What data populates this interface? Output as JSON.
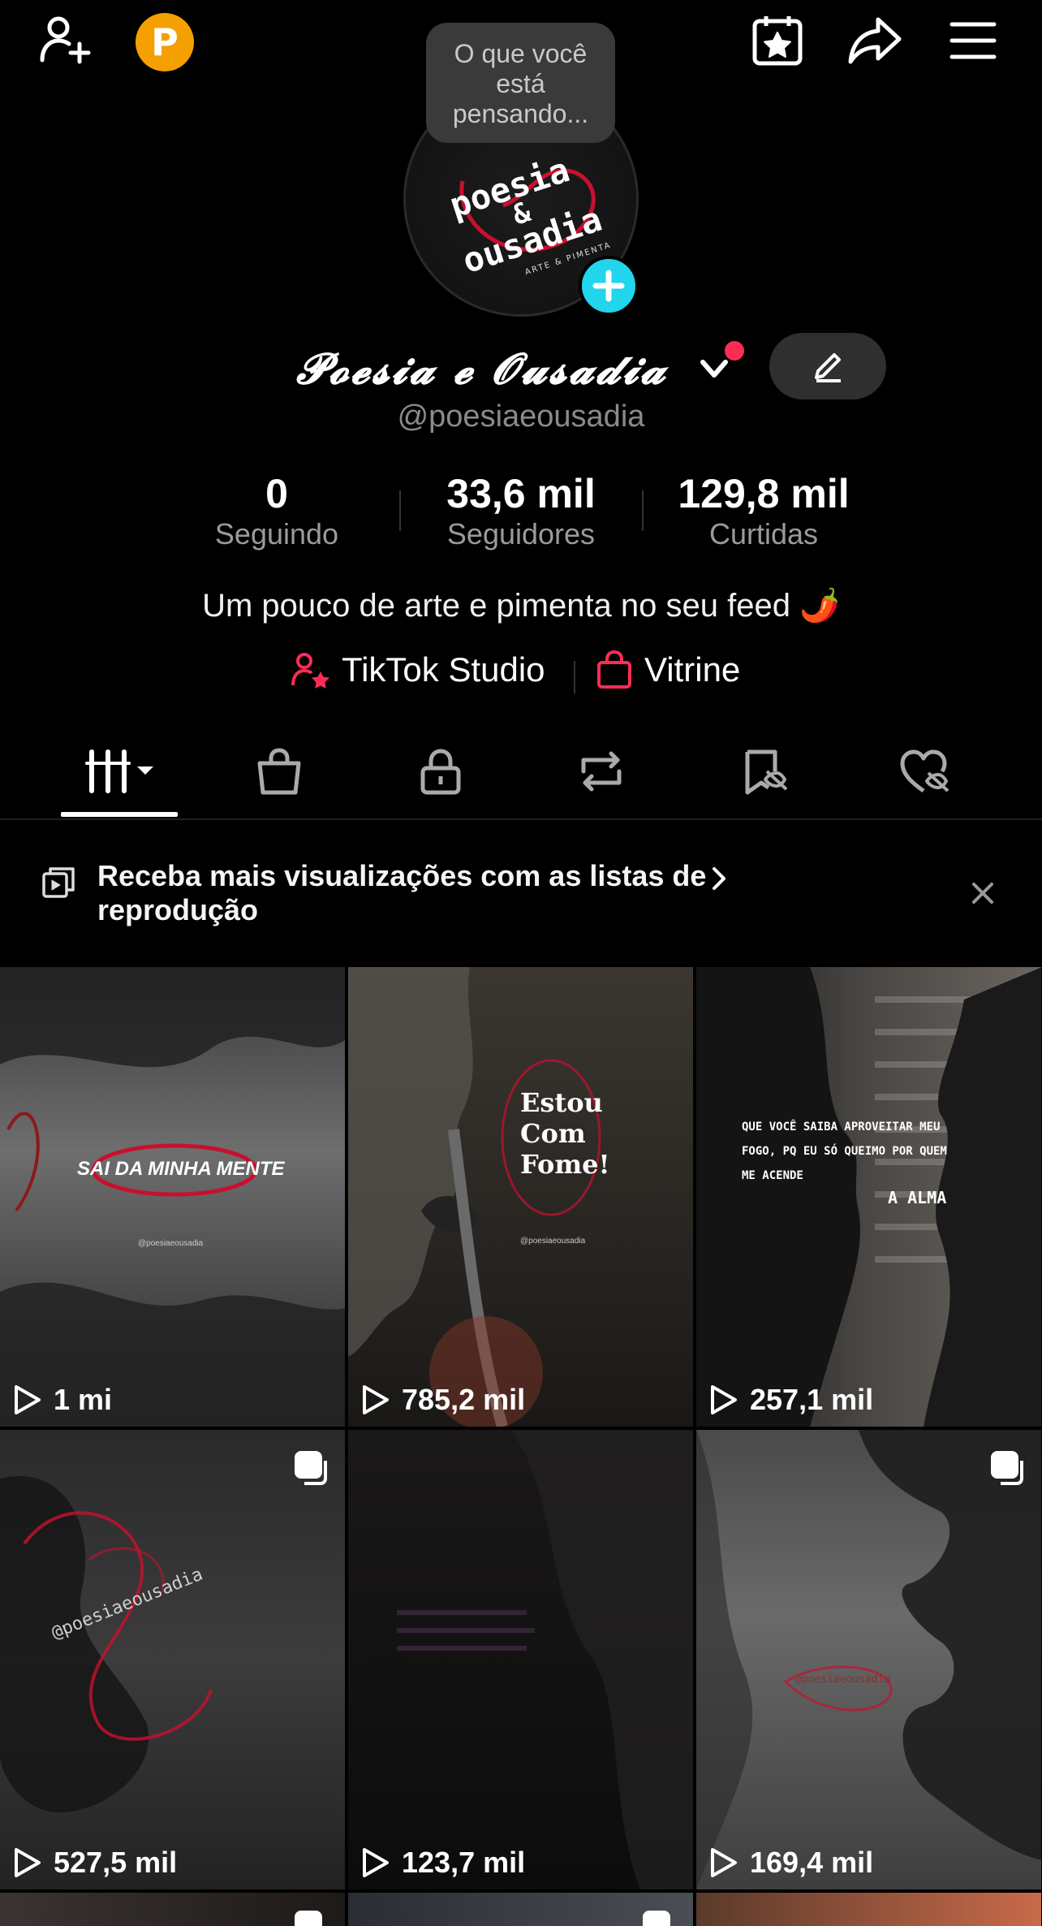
{
  "top_bar": {
    "add_friend_icon": "person-plus-icon",
    "coin_label": "P",
    "calendar_icon": "calendar-star-icon",
    "share_icon": "share-arrow-icon",
    "menu_icon": "hamburger-menu-icon"
  },
  "status_bubble": {
    "text": "O que você está pensando..."
  },
  "profile": {
    "avatar_logo": {
      "line1": "poesia",
      "line2": "&",
      "line3": "ousadia",
      "tagline": "ARTE & PIMENTA"
    },
    "display_name": "𝓟𝓸𝓮𝓼𝓲𝓪 𝓮 𝓞𝓾𝓼𝓪𝓭𝓲𝓪",
    "handle": "@poesiaeousadia"
  },
  "stats": [
    {
      "value": "0",
      "label": "Seguindo"
    },
    {
      "value": "33,6 mil",
      "label": "Seguidores"
    },
    {
      "value": "129,8 mil",
      "label": "Curtidas"
    }
  ],
  "bio": "Um pouco de arte e pimenta no seu feed 🌶️",
  "links": {
    "studio": "TikTok Studio",
    "showcase": "Vitrine"
  },
  "tabs": [
    {
      "name": "videos",
      "icon": "grid-lines-icon"
    },
    {
      "name": "shop",
      "icon": "shopping-bag-icon"
    },
    {
      "name": "private",
      "icon": "lock-icon"
    },
    {
      "name": "reposts",
      "icon": "repost-icon"
    },
    {
      "name": "favorites",
      "icon": "bookmark-hidden-icon"
    },
    {
      "name": "liked",
      "icon": "heart-hidden-icon"
    }
  ],
  "banner": {
    "text": "Receba mais visualizações com as listas de reprodução",
    "chevron": "›"
  },
  "videos": [
    {
      "views": "1 mi",
      "overlay": "SAI DA MINHA MENTE",
      "watermark": "@poesiaeousadia",
      "multi": false
    },
    {
      "views": "785,2 mil",
      "overlay": "Estou Com Fome!",
      "watermark": "@poesiaeousadia",
      "multi": false
    },
    {
      "views": "257,1 mil",
      "overlay": "QUE VOCÊ SAIBA APROVEITAR MEU FOGO, PQ EU SÓ QUEIMO POR QUEM ME ACENDE",
      "overlay2": "A ALMA",
      "multi": false
    },
    {
      "views": "527,5 mil",
      "watermark": "@poesiaeousadia",
      "multi": true
    },
    {
      "views": "123,7 mil",
      "multi": false
    },
    {
      "views": "169,4 mil",
      "watermark": "@poesiaeousadia",
      "multi": true
    }
  ],
  "colors": {
    "background": "#000000",
    "accent_cyan": "#20d5ec",
    "accent_red": "#fe2c55",
    "coin": "#f4a000"
  }
}
